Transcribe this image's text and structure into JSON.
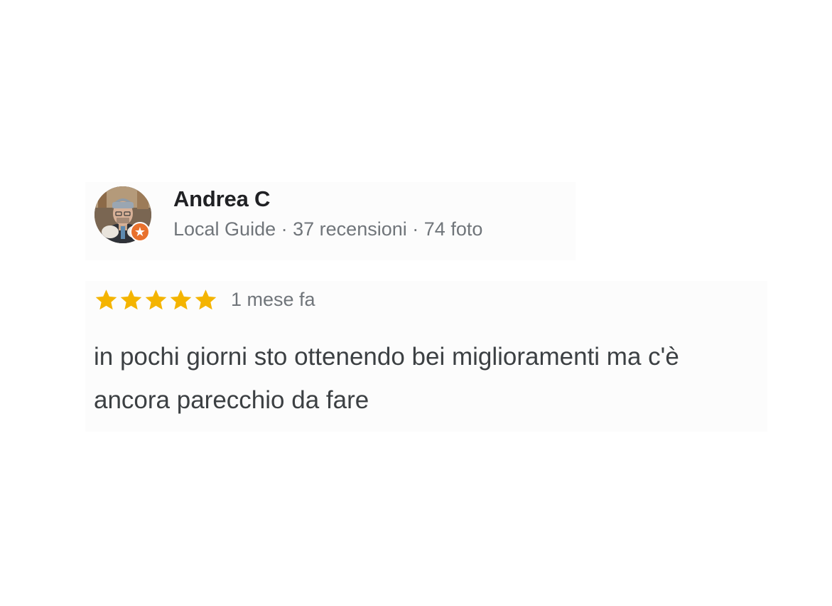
{
  "reviewer": {
    "name": "Andrea C",
    "level": "Local Guide",
    "separator": "·",
    "reviews_count": "37 recensioni",
    "photos_count": "74 foto",
    "badge_icon": "star-icon",
    "badge_color": "#e8712d"
  },
  "review": {
    "rating": 5,
    "max_rating": 5,
    "star_color": "#f4b400",
    "date": "1 mese fa",
    "text": "in pochi giorni sto ottenendo bei miglioramenti ma c'è ancora parecchio da fare"
  }
}
